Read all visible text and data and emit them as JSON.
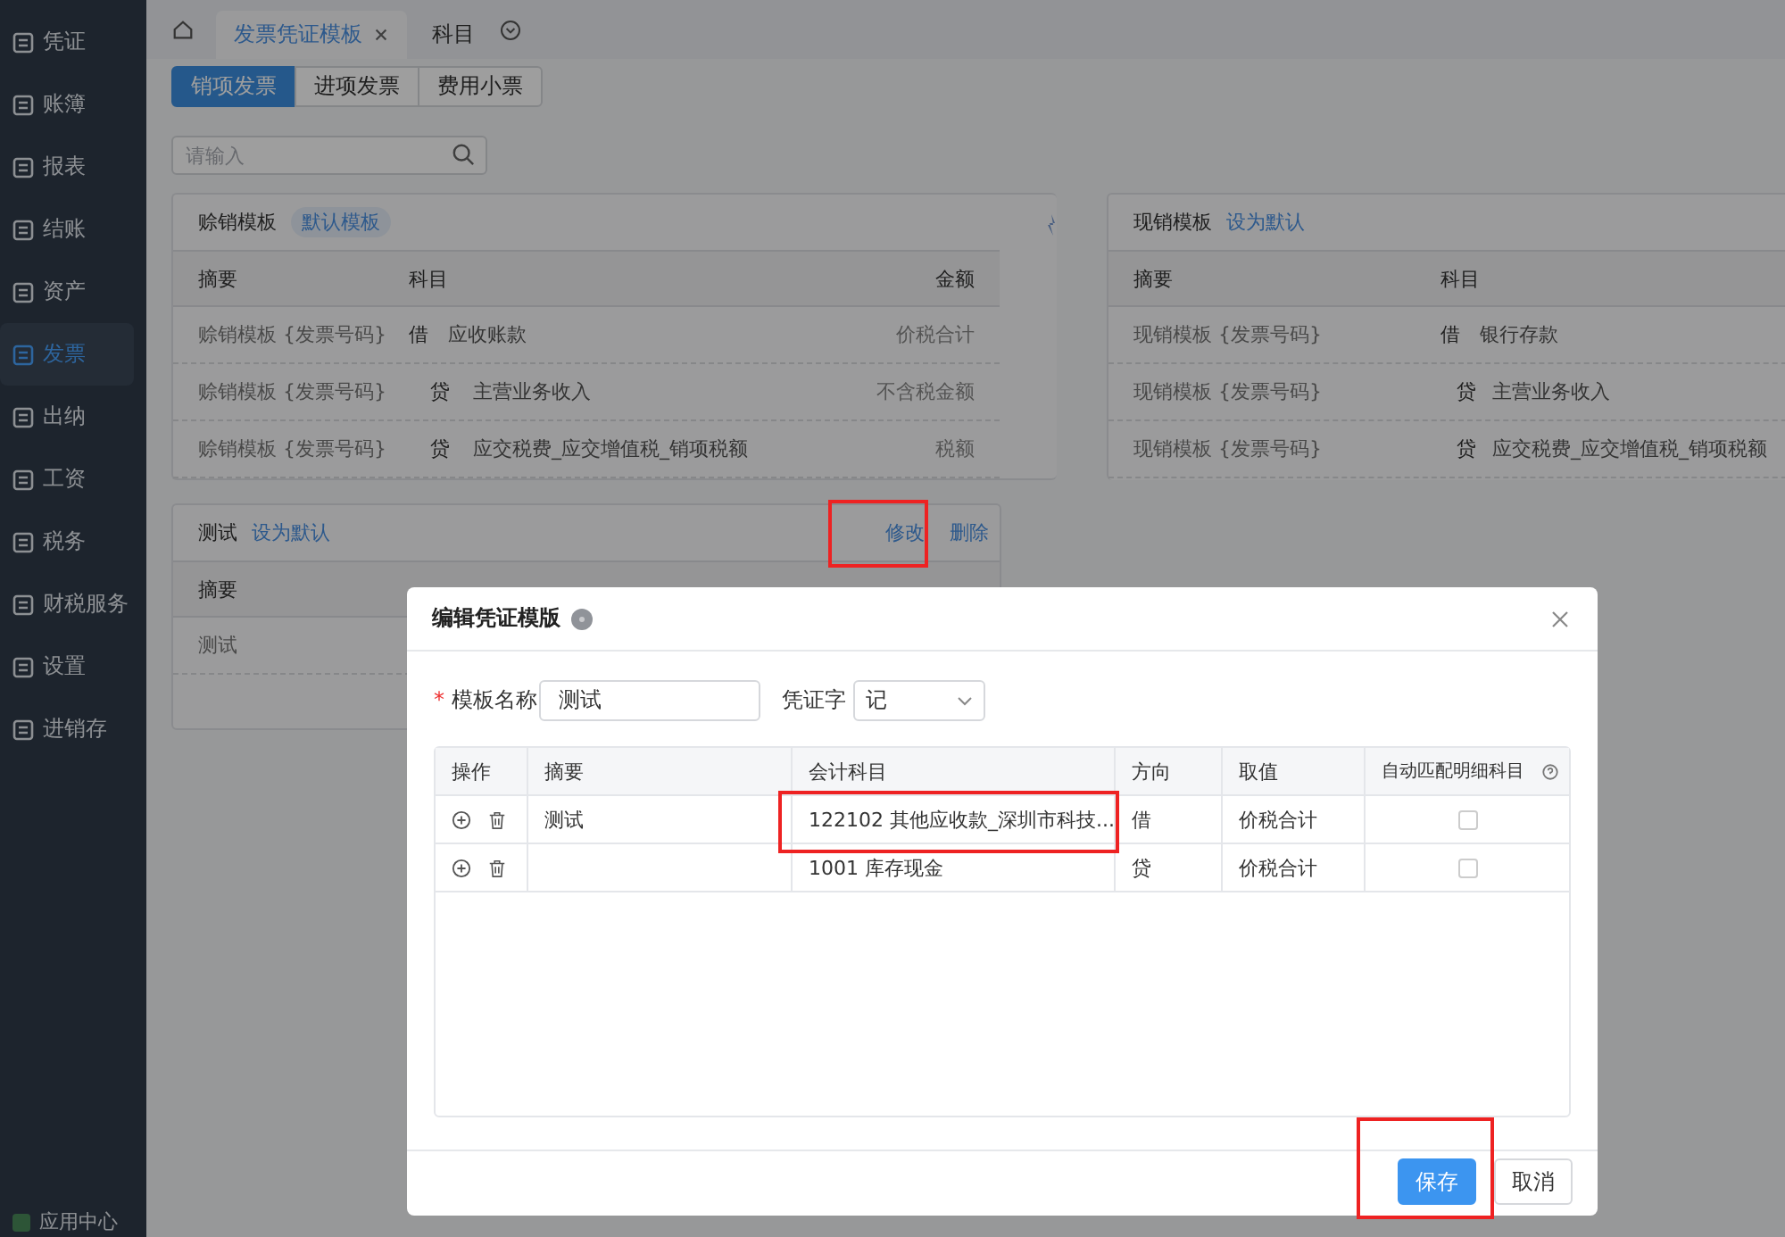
{
  "sidebar": {
    "items": [
      {
        "label": "凭证",
        "selected": false
      },
      {
        "label": "账簿",
        "selected": false
      },
      {
        "label": "报表",
        "selected": false
      },
      {
        "label": "结账",
        "selected": false
      },
      {
        "label": "资产",
        "selected": false
      },
      {
        "label": "发票",
        "selected": true
      },
      {
        "label": "出纳",
        "selected": false
      },
      {
        "label": "工资",
        "selected": false
      },
      {
        "label": "税务",
        "selected": false
      },
      {
        "label": "财税服务",
        "selected": false
      },
      {
        "label": "设置",
        "selected": false
      },
      {
        "label": "进销存",
        "selected": false
      }
    ],
    "footer": "应用中心"
  },
  "tabs": [
    {
      "label": "发票凭证模板",
      "selected": true,
      "closable": true
    },
    {
      "label": "科目",
      "selected": false,
      "closable": false
    }
  ],
  "invoice_tabs": [
    {
      "label": "销项发票",
      "selected": true
    },
    {
      "label": "进项发票",
      "selected": false
    },
    {
      "label": "费用小票",
      "selected": false
    }
  ],
  "search": {
    "placeholder": "请输入"
  },
  "templates": [
    {
      "name": "赊销模板",
      "tag": "默认模板",
      "columns": [
        "摘要",
        "科目",
        "金额"
      ],
      "rows": [
        {
          "summary": "赊销模板 {发票号码}",
          "direction": "借",
          "account": "应收账款",
          "amount": "价税合计"
        },
        {
          "summary": "赊销模板 {发票号码}",
          "direction": "贷",
          "account": "主营业务收入",
          "amount": "不含税金额"
        },
        {
          "summary": "赊销模板 {发票号码}",
          "direction": "贷",
          "account": "应交税费_应交增值税_销项税额",
          "amount": "税额"
        }
      ]
    },
    {
      "name": "现销模板",
      "link": "设为默认",
      "columns": [
        "摘要",
        "科目"
      ],
      "rows": [
        {
          "summary": "现销模板 {发票号码}",
          "direction": "借",
          "account": "银行存款"
        },
        {
          "summary": "现销模板 {发票号码}",
          "direction": "贷",
          "account": "主营业务收入"
        },
        {
          "summary": "现销模板 {发票号码}",
          "direction": "贷",
          "account": "应交税费_应交增值税_销项税额"
        }
      ]
    },
    {
      "name": "测试",
      "link": "设为默认",
      "actions": [
        "修改",
        "删除"
      ],
      "columns": [
        "摘要"
      ],
      "rows": [
        {
          "summary": "测试"
        }
      ]
    }
  ],
  "dialog": {
    "title": "编辑凭证模版",
    "required_mark": "*",
    "name_label": "模板名称",
    "name_value": "测试",
    "word_label": "凭证字",
    "word_value": "记",
    "columns": [
      "操作",
      "摘要",
      "会计科目",
      "方向",
      "取值",
      "自动匹配明细科目"
    ],
    "rows": [
      {
        "summary": "测试",
        "account": "122102 其他应收款_深圳市科技...",
        "direction": "借",
        "value": "价税合计",
        "checked": false
      },
      {
        "account": "1001 库存现金",
        "direction": "贷",
        "value": "价税合计",
        "checked": false
      }
    ],
    "buttons": [
      {
        "label": "保存",
        "kind": "primary"
      },
      {
        "label": "取消",
        "kind": "default"
      }
    ]
  }
}
